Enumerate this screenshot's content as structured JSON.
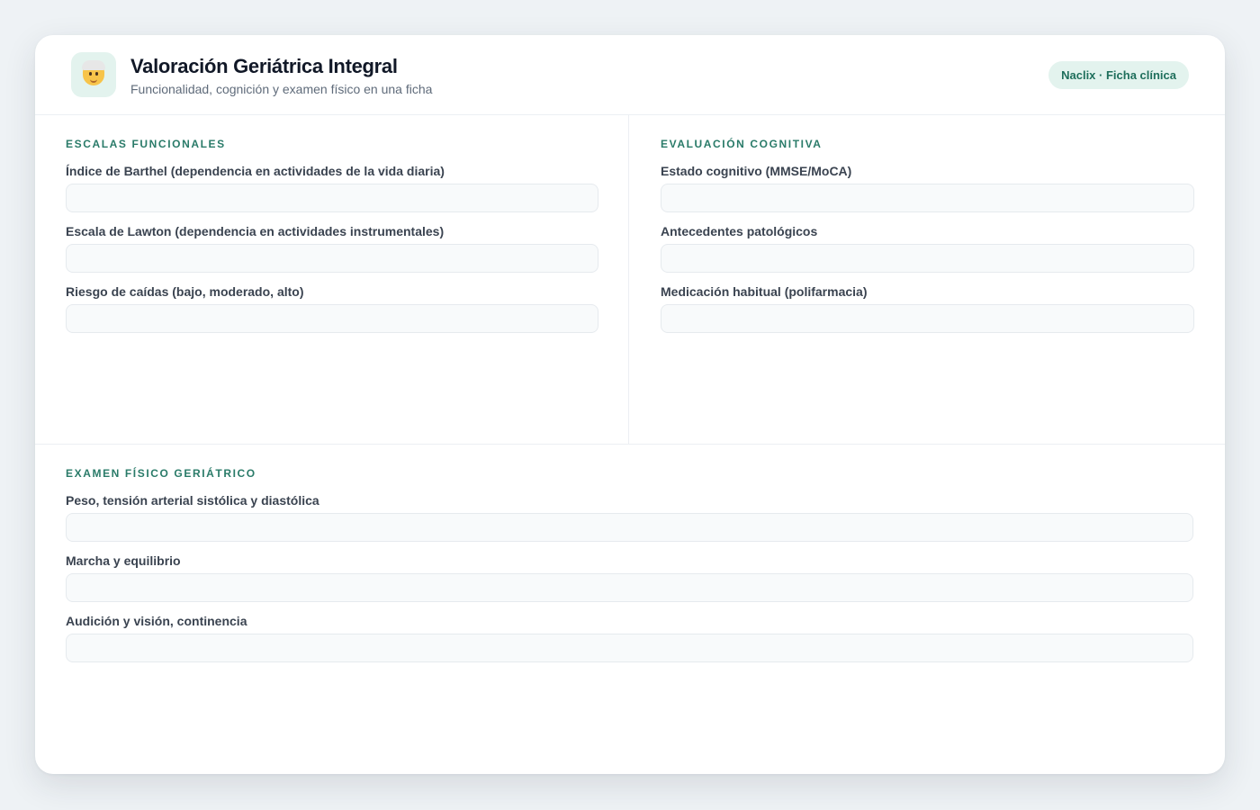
{
  "header": {
    "title": "Valoración Geriátrica Integral",
    "subtitle": "Funcionalidad, cognición y examen físico en una ficha",
    "badge": "Naclix · Ficha clínica",
    "logo_icon": "older-person-icon"
  },
  "sections": {
    "functional": {
      "title": "ESCALAS FUNCIONALES",
      "fields": [
        {
          "label": "Índice de Barthel (dependencia en actividades de la vida diaria)",
          "value": ""
        },
        {
          "label": "Escala de Lawton (dependencia en actividades instrumentales)",
          "value": ""
        },
        {
          "label": "Riesgo de caídas (bajo, moderado, alto)",
          "value": ""
        }
      ]
    },
    "cognitive": {
      "title": "EVALUACIÓN COGNITIVA",
      "fields": [
        {
          "label": "Estado cognitivo (MMSE/MoCA)",
          "value": ""
        },
        {
          "label": "Antecedentes patológicos",
          "value": ""
        },
        {
          "label": "Medicación habitual (polifarmacia)",
          "value": ""
        }
      ]
    },
    "exam": {
      "title": "EXAMEN FÍSICO GERIÁTRICO",
      "fields": [
        {
          "label": "Peso, tensión arterial sistólica y diastólica",
          "value": ""
        },
        {
          "label": "Marcha y equilibrio",
          "value": ""
        },
        {
          "label": "Audición y visión, continencia",
          "value": ""
        }
      ]
    }
  },
  "colors": {
    "accent": "#2a7b69",
    "badge_bg": "#e3f3ee",
    "background": "#eef2f5"
  }
}
